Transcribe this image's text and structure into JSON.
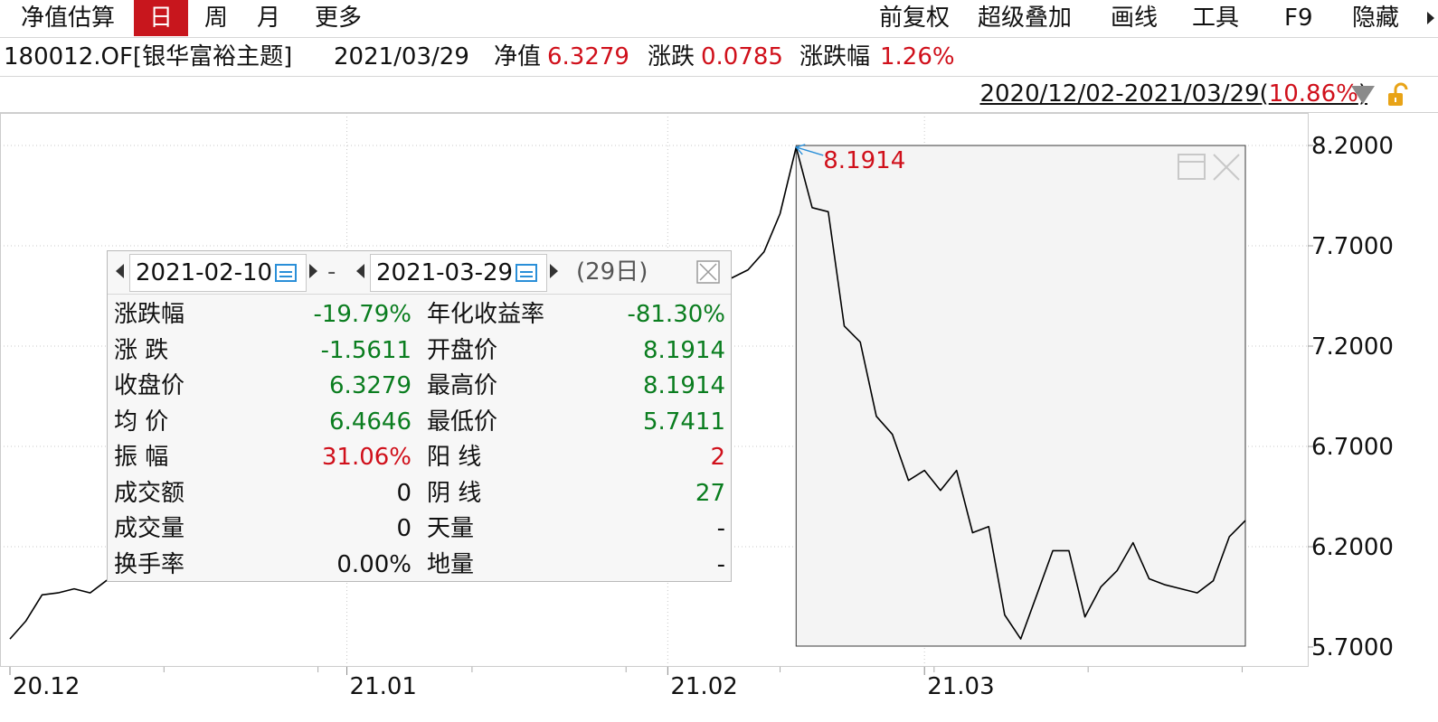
{
  "tabs": [
    "净值估算",
    "日",
    "周",
    "月",
    "更多"
  ],
  "active_tab": "日",
  "toolbar": [
    "前复权",
    "超级叠加",
    "画线",
    "工具",
    "F9",
    "隐藏"
  ],
  "info": {
    "fund": "180012.OF[银华富裕主题]",
    "date": "2021/03/29",
    "nav_label": "净值",
    "nav_value": "6.3279",
    "change_label": "涨跌",
    "change_value": "0.0785",
    "pct_label": "涨跌幅",
    "pct_value": "1.26%"
  },
  "range": {
    "text": "2020/12/02-2021/03/29",
    "open_paren": "(",
    "pct": "10.86%",
    "close_paren": ")"
  },
  "colors": {
    "up": "#d0101b",
    "down": "#0a7d1f",
    "tab_active": "#c8161d",
    "calendar": "#2a8fd8"
  },
  "icons": {
    "dropdown": "triangle-down-icon",
    "lock": "lock-icon",
    "calendar": "calendar-icon",
    "close": "close-icon"
  },
  "popup": {
    "start_date": "2021-02-10",
    "dash": "-",
    "end_date": "2021-03-29",
    "days": "(29日)",
    "rows": [
      {
        "l1": "涨跌幅",
        "v1": "-19.79%",
        "c1": "down",
        "l2": "年化收益率",
        "v2": "-81.30%",
        "c2": "down"
      },
      {
        "l1": "涨  跌",
        "v1": "-1.5611",
        "c1": "down",
        "l2": "开盘价",
        "v2": "8.1914",
        "c2": "down"
      },
      {
        "l1": "收盘价",
        "v1": "6.3279",
        "c1": "down",
        "l2": "最高价",
        "v2": "8.1914",
        "c2": "down"
      },
      {
        "l1": "均  价",
        "v1": "6.4646",
        "c1": "down",
        "l2": "最低价",
        "v2": "5.7411",
        "c2": "down"
      },
      {
        "l1": "振  幅",
        "v1": "31.06%",
        "c1": "up",
        "l2": "阳  线",
        "v2": "2",
        "c2": "up"
      },
      {
        "l1": "成交额",
        "v1": "0",
        "c1": "plain",
        "l2": "阴  线",
        "v2": "27",
        "c2": "down"
      },
      {
        "l1": "成交量",
        "v1": "0",
        "c1": "plain",
        "l2": "天量",
        "v2": "-",
        "c2": "plain"
      },
      {
        "l1": "换手率",
        "v1": "0.00%",
        "c1": "plain",
        "l2": "地量",
        "v2": "-",
        "c2": "plain"
      }
    ]
  },
  "chart_data": {
    "type": "line",
    "ylim": [
      5.62,
      8.34
    ],
    "yticks": [
      8.2,
      7.7,
      7.2,
      6.7,
      6.2,
      5.7
    ],
    "ytick_labels": [
      "8.2000",
      "7.7000",
      "7.2000",
      "6.7000",
      "6.2000",
      "5.7000"
    ],
    "xtick_labels": [
      {
        "label": "20.12",
        "index": 0
      },
      {
        "label": "21.01",
        "index": 21
      },
      {
        "label": "21.02",
        "index": 41
      },
      {
        "label": "21.03",
        "index": 57
      }
    ],
    "max_label": "8.1914",
    "series": [
      {
        "values": [
          5.74,
          5.83,
          5.96,
          5.97,
          5.99,
          5.97,
          6.03,
          6.08,
          6.13,
          6.18,
          6.21,
          6.24,
          6.26,
          6.28,
          6.31,
          6.33,
          6.36,
          6.38,
          6.41,
          6.44,
          6.47,
          6.52,
          6.57,
          6.62,
          6.67,
          6.71,
          6.74,
          6.78,
          6.82,
          6.86,
          6.9,
          6.94,
          6.99,
          7.03,
          7.07,
          7.11,
          7.15,
          7.19,
          7.23,
          7.27,
          7.31,
          7.36,
          7.41,
          7.46,
          7.51,
          7.54,
          7.58,
          7.67,
          7.86,
          8.1914,
          7.89,
          7.87,
          7.3,
          7.22,
          6.85,
          6.76,
          6.53,
          6.58,
          6.48,
          6.58,
          6.27,
          6.3,
          5.86,
          5.74,
          5.96,
          6.18,
          6.18,
          5.85,
          6.0,
          6.08,
          6.22,
          6.04,
          6.01,
          5.99,
          5.97,
          6.03,
          6.25,
          6.33
        ]
      }
    ],
    "selection": {
      "start_index": 49,
      "end_index": 77
    }
  }
}
